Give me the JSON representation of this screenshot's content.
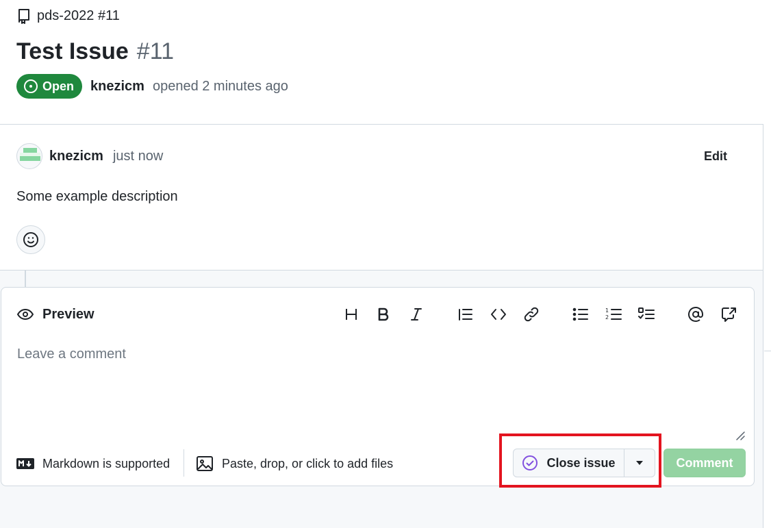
{
  "breadcrumb": {
    "text": "pds-2022 #11",
    "icon": "repo-icon"
  },
  "issue": {
    "title": "Test Issue",
    "number": "#11",
    "status": "Open",
    "author": "knezicm",
    "opened_text": "opened 2 minutes ago"
  },
  "comment": {
    "author": "knezicm",
    "time": "just now",
    "edit_label": "Edit",
    "body": "Some example description"
  },
  "composer": {
    "tab_label": "Preview",
    "placeholder": "Leave a comment",
    "markdown_note": "Markdown is supported",
    "files_note": "Paste, drop, or click to add files",
    "close_label": "Close issue",
    "comment_label": "Comment"
  },
  "colors": {
    "open_green": "#1f883d",
    "closed_purple": "#8250df",
    "comment_disabled": "#94d3a2",
    "highlight_red": "#e3141f"
  }
}
